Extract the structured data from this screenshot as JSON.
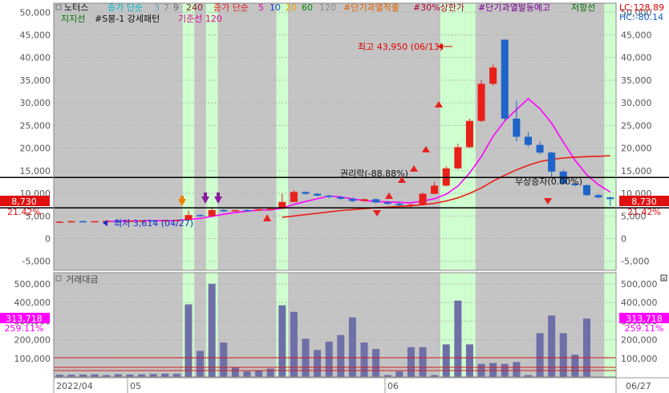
{
  "legend": {
    "stock_name": "노터스",
    "ma_label": "종가 단순",
    "ma_periods_a": [
      "3",
      "7",
      "9",
      "240"
    ],
    "ma_label_b": "종가 단순",
    "ma_periods_b": [
      "5",
      "10",
      "20",
      "60",
      "120"
    ],
    "signal_1": "#단기과열적출",
    "signal_2": "#30%상한가",
    "signal_3": "#단기과열발동예고",
    "resistance": "저항선",
    "support": "지지선",
    "pattern": "#S봉-1 강세패턴",
    "base_line": "기준선 120"
  },
  "top_right": {
    "lc": "LC:128.89",
    "hc": "HC:-80.14"
  },
  "price_panel": {
    "current_price": "8,730",
    "current_pct": "21.42%",
    "annotation_high": "최고 43,950 (06/13)",
    "annotation_low": "최저 3,614 (04/27)",
    "annotation_rights": "권리락(-88.88%)",
    "annotation_bonus": "무상증자(0.00%)"
  },
  "volume_panel": {
    "title": "거래대금",
    "current_value": "313,718",
    "current_pct": "259.11%"
  },
  "x_axis": {
    "labels": [
      "2022/04",
      "05",
      "06"
    ],
    "right_label": "06/27"
  },
  "colors": {
    "up": "#e8201a",
    "down": "#1f64c8",
    "highlight": "#cfffcf",
    "background": "#c4c4c4",
    "volume": "#6f6fa8",
    "accent": "#ff0000"
  },
  "chart_data": {
    "type": "candlestick",
    "price_axis": {
      "ylim": [
        -7000,
        52000
      ],
      "ticks": [
        50000,
        45000,
        40000,
        35000,
        30000,
        25000,
        20000,
        15000,
        10000,
        5000,
        0,
        -5000
      ]
    },
    "volume_axis": {
      "ylim": [
        0,
        560000
      ],
      "ticks": [
        500000,
        400000,
        300000,
        200000,
        100000
      ]
    },
    "horizontal_lines": [
      13500,
      6800
    ],
    "highlighted_bar_indices": [
      11,
      13,
      19,
      33,
      34,
      35,
      47
    ],
    "candles": [
      {
        "o": 3700,
        "h": 3900,
        "l": 3614,
        "c": 3750
      },
      {
        "o": 3800,
        "h": 3950,
        "l": 3700,
        "c": 3850
      },
      {
        "o": 3850,
        "h": 3950,
        "l": 3750,
        "c": 3800
      },
      {
        "o": 3800,
        "h": 3900,
        "l": 3700,
        "c": 3850
      },
      {
        "o": 3850,
        "h": 4000,
        "l": 3800,
        "c": 3900
      },
      {
        "o": 3900,
        "h": 4000,
        "l": 3800,
        "c": 3850
      },
      {
        "o": 3850,
        "h": 4000,
        "l": 3800,
        "c": 3950
      },
      {
        "o": 3950,
        "h": 4100,
        "l": 3900,
        "c": 4000
      },
      {
        "o": 4000,
        "h": 4150,
        "l": 3900,
        "c": 3950
      },
      {
        "o": 3950,
        "h": 4100,
        "l": 3900,
        "c": 4050
      },
      {
        "o": 4050,
        "h": 4200,
        "l": 4000,
        "c": 4100
      },
      {
        "o": 4100,
        "h": 6200,
        "l": 4050,
        "c": 5200
      },
      {
        "o": 5200,
        "h": 5400,
        "l": 4900,
        "c": 5000
      },
      {
        "o": 5000,
        "h": 6800,
        "l": 4900,
        "c": 6300
      },
      {
        "o": 6300,
        "h": 6500,
        "l": 5900,
        "c": 6100
      },
      {
        "o": 6100,
        "h": 6400,
        "l": 6000,
        "c": 6300
      },
      {
        "o": 6300,
        "h": 6500,
        "l": 6100,
        "c": 6200
      },
      {
        "o": 6200,
        "h": 6600,
        "l": 6100,
        "c": 6500
      },
      {
        "o": 6500,
        "h": 6800,
        "l": 6300,
        "c": 6600
      },
      {
        "o": 6600,
        "h": 9900,
        "l": 6500,
        "c": 8100
      },
      {
        "o": 8100,
        "h": 10700,
        "l": 8000,
        "c": 10300
      },
      {
        "o": 10300,
        "h": 10400,
        "l": 9700,
        "c": 9900
      },
      {
        "o": 9900,
        "h": 10100,
        "l": 9300,
        "c": 9500
      },
      {
        "o": 9500,
        "h": 9700,
        "l": 8900,
        "c": 9200
      },
      {
        "o": 9200,
        "h": 9400,
        "l": 8500,
        "c": 8800
      },
      {
        "o": 8800,
        "h": 9100,
        "l": 8100,
        "c": 8300
      },
      {
        "o": 8300,
        "h": 8900,
        "l": 8200,
        "c": 8700
      },
      {
        "o": 8700,
        "h": 8800,
        "l": 7800,
        "c": 8000
      },
      {
        "o": 8000,
        "h": 8300,
        "l": 7400,
        "c": 7700
      },
      {
        "o": 7700,
        "h": 8100,
        "l": 7200,
        "c": 7400
      },
      {
        "o": 7400,
        "h": 7700,
        "l": 6800,
        "c": 7500
      },
      {
        "o": 7500,
        "h": 10200,
        "l": 7300,
        "c": 9900
      },
      {
        "o": 9900,
        "h": 12500,
        "l": 9800,
        "c": 11700
      },
      {
        "o": 11700,
        "h": 16000,
        "l": 11500,
        "c": 15500
      },
      {
        "o": 15500,
        "h": 21000,
        "l": 15300,
        "c": 20200
      },
      {
        "o": 20200,
        "h": 26500,
        "l": 20000,
        "c": 26000
      },
      {
        "o": 26000,
        "h": 35000,
        "l": 25800,
        "c": 34200
      },
      {
        "o": 34200,
        "h": 38500,
        "l": 33800,
        "c": 37800
      },
      {
        "o": 43950,
        "h": 43950,
        "l": 26000,
        "c": 26500
      },
      {
        "o": 26500,
        "h": 30500,
        "l": 21500,
        "c": 22500
      },
      {
        "o": 22500,
        "h": 23500,
        "l": 20200,
        "c": 20700
      },
      {
        "o": 20700,
        "h": 21500,
        "l": 18600,
        "c": 19000
      },
      {
        "o": 19000,
        "h": 19200,
        "l": 13700,
        "c": 14800
      },
      {
        "o": 14800,
        "h": 15200,
        "l": 12000,
        "c": 12100
      },
      {
        "o": 12100,
        "h": 12300,
        "l": 11500,
        "c": 11800
      },
      {
        "o": 11800,
        "h": 12000,
        "l": 9400,
        "c": 9600
      },
      {
        "o": 9600,
        "h": 9900,
        "l": 8900,
        "c": 9100
      },
      {
        "o": 9100,
        "h": 9300,
        "l": 7200,
        "c": 8730
      }
    ],
    "volume": [
      12000,
      12000,
      13000,
      14000,
      10000,
      15000,
      13000,
      14000,
      16000,
      18000,
      17000,
      390000,
      140000,
      500000,
      185000,
      50000,
      30000,
      35000,
      45000,
      385000,
      350000,
      205000,
      145000,
      190000,
      225000,
      320000,
      185000,
      150000,
      10000,
      30000,
      160000,
      160000,
      10000,
      175000,
      410000,
      175000,
      70000,
      75000,
      70000,
      80000,
      10000,
      235000,
      330000,
      235000,
      120000,
      313718,
      0,
      0
    ],
    "moving_averages": [
      {
        "period": "5",
        "color": "#ff00ff",
        "values": [
          null,
          null,
          null,
          null,
          3790,
          3830,
          3870,
          3900,
          3930,
          3960,
          4010,
          4250,
          4470,
          4900,
          5380,
          5780,
          6060,
          6280,
          6340,
          6740,
          7540,
          8200,
          8780,
          9400,
          9200,
          8760,
          8400,
          8200,
          8100,
          8000,
          7900,
          8300,
          8800,
          9800,
          11600,
          14500,
          18100,
          22600,
          26000,
          28500,
          30900,
          28700,
          25500,
          21300,
          17300,
          14100,
          11900,
          10300
        ]
      },
      {
        "period": "20",
        "color": "#e8201a",
        "values": [
          null,
          null,
          null,
          null,
          null,
          null,
          null,
          null,
          null,
          null,
          null,
          null,
          null,
          null,
          null,
          null,
          null,
          null,
          null,
          4700,
          5000,
          5300,
          5600,
          5900,
          6200,
          6400,
          6600,
          6800,
          6950,
          7100,
          7250,
          7500,
          7800,
          8300,
          9000,
          10000,
          11200,
          12700,
          14000,
          15200,
          16200,
          17000,
          17500,
          17800,
          18000,
          18100,
          18200,
          18300
        ]
      },
      {
        "period": "60",
        "color": "#008800",
        "values": [
          null,
          null,
          null,
          null,
          null,
          null,
          null,
          null,
          null,
          null,
          null,
          null,
          null,
          null,
          null,
          null,
          null,
          null,
          null,
          null,
          null,
          null,
          null,
          null,
          null,
          null,
          null,
          null,
          null,
          null,
          null,
          null,
          null,
          null,
          null,
          null,
          null,
          null,
          null,
          null,
          null,
          null,
          null,
          null,
          null,
          null,
          null,
          null
        ]
      },
      {
        "period": "120",
        "color": "#808080",
        "values": [
          null,
          null,
          null,
          null,
          null,
          null,
          null,
          null,
          null,
          null,
          null,
          null,
          null,
          null,
          null,
          null,
          null,
          null,
          null,
          null,
          null,
          null,
          null,
          null,
          null,
          null,
          null,
          null,
          null,
          null,
          null,
          null,
          null,
          null,
          null,
          null,
          null,
          null,
          null,
          null,
          null,
          null,
          null,
          null,
          null,
          null,
          null,
          null
        ]
      }
    ]
  }
}
